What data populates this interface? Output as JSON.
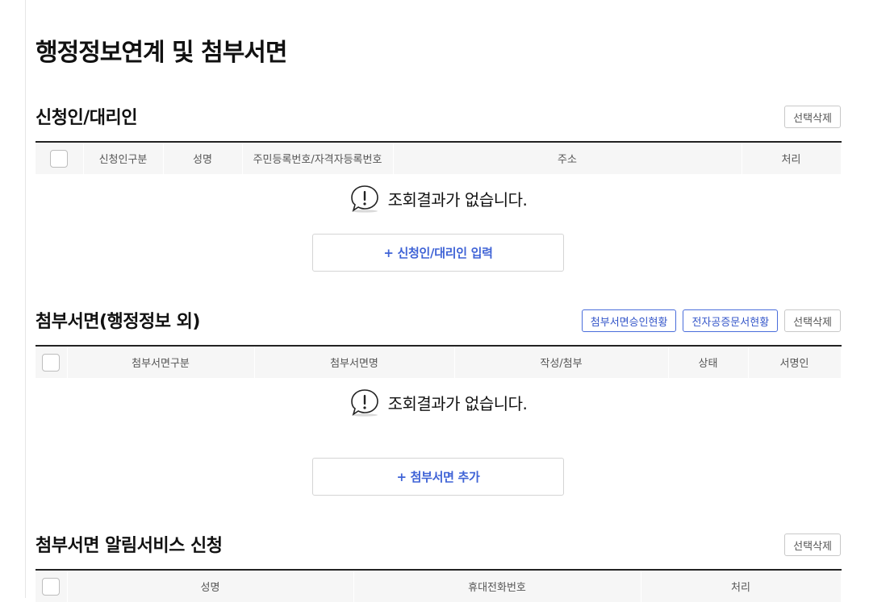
{
  "page": {
    "title": "행정정보연계 및 첨부서면"
  },
  "applicant": {
    "title": "신청인/대리인",
    "delete_label": "선택삭제",
    "columns": [
      "신청인구분",
      "성명",
      "주민등록번호/자격자등록번호",
      "주소",
      "처리"
    ],
    "empty_text": "조회결과가 없습니다.",
    "add_label": "+ 신청인/대리인 입력"
  },
  "attachments": {
    "title": "첨부서면(행정정보 외)",
    "approval_label": "첨부서면승인현황",
    "notary_label": "전자공증문서현황",
    "delete_label": "선택삭제",
    "columns": [
      "첨부서면구분",
      "첨부서면명",
      "작성/첨부",
      "상태",
      "서명인"
    ],
    "empty_text": "조회결과가 없습니다.",
    "add_label": "+ 첨부서면 추가"
  },
  "notify": {
    "title": "첨부서면 알림서비스 신청",
    "delete_label": "선택삭제",
    "columns": [
      "성명",
      "휴대전화번호",
      "처리"
    ]
  },
  "colors": {
    "accent": "#3f63d6",
    "button_blue": "#4a6ddb",
    "header_bg": "#f6f6f6"
  },
  "icons": {
    "empty": "alert-speech-bubble-icon",
    "checkbox": "checkbox-icon"
  }
}
